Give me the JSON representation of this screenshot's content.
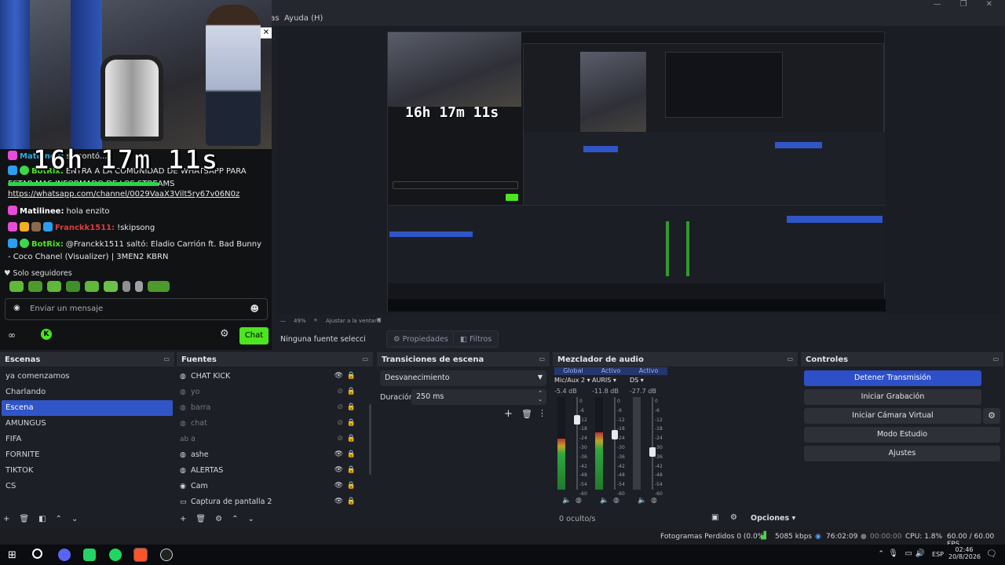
{
  "menu": {
    "partial_item": "ntas",
    "help": "Ayuda (H)"
  },
  "chat": {
    "timer": "16h 17m 11s",
    "messages": [
      {
        "user": "Matilinee:",
        "text": "se contó...",
        "user_color": "#2ea9e0"
      },
      {
        "user": "BotRix:",
        "text": "ENTRA A LA COMUNIDAD DE WHATSAPP PARA ESTAR MAS INFORMADO DE LOS STREAMS https://whatsapp.com/channel/0029VaaX3Vilt5ry67v06N0z",
        "user_color": "#4de51f"
      },
      {
        "user": "Matilinee:",
        "text": "hola enzito",
        "user_color": "#ffffff"
      },
      {
        "user": "Franckk1511:",
        "text": "!skipsong",
        "user_color": "#e23b3b"
      },
      {
        "user": "BotRix:",
        "text": "@Franckk1511 saltó: Eladio Carrión ft. Bad Bunny - Coco Chanel (Visualizer) | 3MEN2 KBRN",
        "user_color": "#4de51f"
      }
    ],
    "link": "https://whatsapp.com/channel/0029VaaX3Vilt5ry67v06N0z",
    "followers_only": "Solo seguidores",
    "input_placeholder": "Enviar un mensaje",
    "chat_button": "Chat",
    "infinity": "∞"
  },
  "preview_bar": {
    "zoom": "49%",
    "fit": "Ajustar a la ventana"
  },
  "selection": {
    "none_selected": "Ninguna fuente seleccionada",
    "properties": "Propiedades",
    "filters": "Filtros"
  },
  "scenes": {
    "title": "Escenas",
    "items": [
      "ya comenzamos",
      "Charlando",
      "Escena",
      "AMUNGUS",
      "FIFA",
      "FORNITE",
      "TIKTOK",
      "CS"
    ],
    "selected_index": 2
  },
  "sources": {
    "title": "Fuentes",
    "items": [
      {
        "name": "CHAT KICK",
        "visible": true,
        "icon": "browser-icon"
      },
      {
        "name": "yo",
        "visible": false,
        "icon": "browser-icon"
      },
      {
        "name": "barra",
        "visible": false,
        "icon": "browser-icon"
      },
      {
        "name": "chat",
        "visible": false,
        "icon": "browser-icon"
      },
      {
        "name": "a",
        "visible": false,
        "icon": "text-icon"
      },
      {
        "name": "ashe",
        "visible": true,
        "icon": "browser-icon"
      },
      {
        "name": "ALERTAS",
        "visible": true,
        "icon": "browser-icon"
      },
      {
        "name": "Cam",
        "visible": true,
        "icon": "camera-icon"
      },
      {
        "name": "Captura de pantalla 2",
        "visible": true,
        "icon": "display-icon"
      }
    ]
  },
  "transitions": {
    "title": "Transiciones de escena",
    "selected": "Desvanecimiento",
    "duration_label": "Duración",
    "duration_value": "250 ms"
  },
  "mixer": {
    "title": "Mezclador de audio",
    "channels": [
      {
        "header": "Global",
        "name": "Mic/Aux 2",
        "db": "-5.4 dB",
        "level": 0.55,
        "fader": 0.78
      },
      {
        "header": "Activo",
        "name": "AURIS",
        "db": "-11.8 dB",
        "level": 0.62,
        "fader": 0.6
      },
      {
        "header": "Activo",
        "name": "DS",
        "db": "-27.7 dB",
        "level": 0.0,
        "fader": 0.4
      }
    ],
    "scale": [
      "0",
      "-6",
      "-12",
      "-18",
      "-24",
      "-30",
      "-36",
      "-42",
      "-48",
      "-54",
      "-60"
    ],
    "hidden": "0 oculto/s",
    "options": "Opciones"
  },
  "controls": {
    "title": "Controles",
    "stop_stream": "Detener Transmisión",
    "start_recording": "Iniciar Grabación",
    "start_vcam": "Iniciar Cámara Virtual",
    "studio_mode": "Modo Estudio",
    "settings": "Ajustes"
  },
  "status": {
    "dropped": "Fotogramas Perdidos 0 (0.0%)",
    "bitrate": "5085 kbps",
    "stream_time": "76:02:09",
    "rec_time": "00:00:00",
    "cpu": "CPU: 1.8%",
    "fps": "60.00 / 60.00 FPS"
  },
  "taskbar": {
    "lang": "ESP",
    "time": "02:46",
    "date": "20/8/2026"
  },
  "colors": {
    "accent": "#3055c7",
    "kick_green": "#4de51f"
  }
}
